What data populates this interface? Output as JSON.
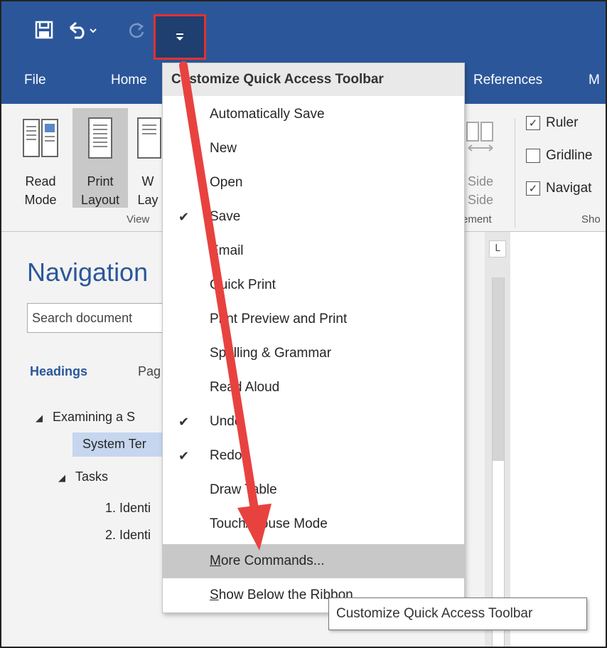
{
  "qat": {
    "save_icon": "save-icon",
    "undo_icon": "undo-icon",
    "redo_icon": "redo-icon",
    "customize_icon": "dropdown-caret-icon"
  },
  "tabs": {
    "file": "File",
    "home": "Home",
    "references": "References",
    "mailings": "M"
  },
  "ribbon": {
    "read_mode": [
      "Read",
      "Mode"
    ],
    "print_layout": [
      "Print",
      "Layout"
    ],
    "web_layout": [
      "W",
      "Lay"
    ],
    "side_to_side": [
      "Side",
      "Side"
    ],
    "group_views": "View",
    "group_arrangement": "ement",
    "group_show": "Sho",
    "ruler": "Ruler",
    "gridlines": "Gridline",
    "navigation": "Navigat"
  },
  "nav": {
    "title": "Navigation",
    "search_placeholder": "Search document",
    "tab_headings": "Headings",
    "tab_pages": "Pag",
    "tree": [
      "Examining a S",
      "System Ter",
      "Tasks",
      "1. Identi",
      "2. Identi"
    ]
  },
  "ruler_corner": "L",
  "menu": {
    "header": "Customize Quick Access Toolbar",
    "items": [
      {
        "label": "Automatically Save",
        "checked": false
      },
      {
        "label": "New",
        "checked": false
      },
      {
        "label": "Open",
        "checked": false
      },
      {
        "label": "Save",
        "checked": true
      },
      {
        "label": "Email",
        "checked": false
      },
      {
        "label": "Quick Print",
        "checked": false
      },
      {
        "label": "Print Preview and Print",
        "checked": false
      },
      {
        "label": "Spelling & Grammar",
        "checked": false
      },
      {
        "label": "Read Aloud",
        "checked": false
      },
      {
        "label": "Undo",
        "checked": true
      },
      {
        "label": "Redo",
        "checked": true
      },
      {
        "label": "Draw Table",
        "checked": false
      },
      {
        "label": "Touch/Mouse Mode",
        "checked": false
      }
    ],
    "more_commands_prefix": "M",
    "more_commands_rest": "ore Commands...",
    "show_below_prefix": "S",
    "show_below_rest": "how Below the Ribbon"
  },
  "tooltip": "Customize Quick Access Toolbar",
  "colors": {
    "title_bar": "#2b579a",
    "highlight_box": "#e5312d",
    "arrow": "#e8423f",
    "menu_hover": "#c8c8c8"
  }
}
